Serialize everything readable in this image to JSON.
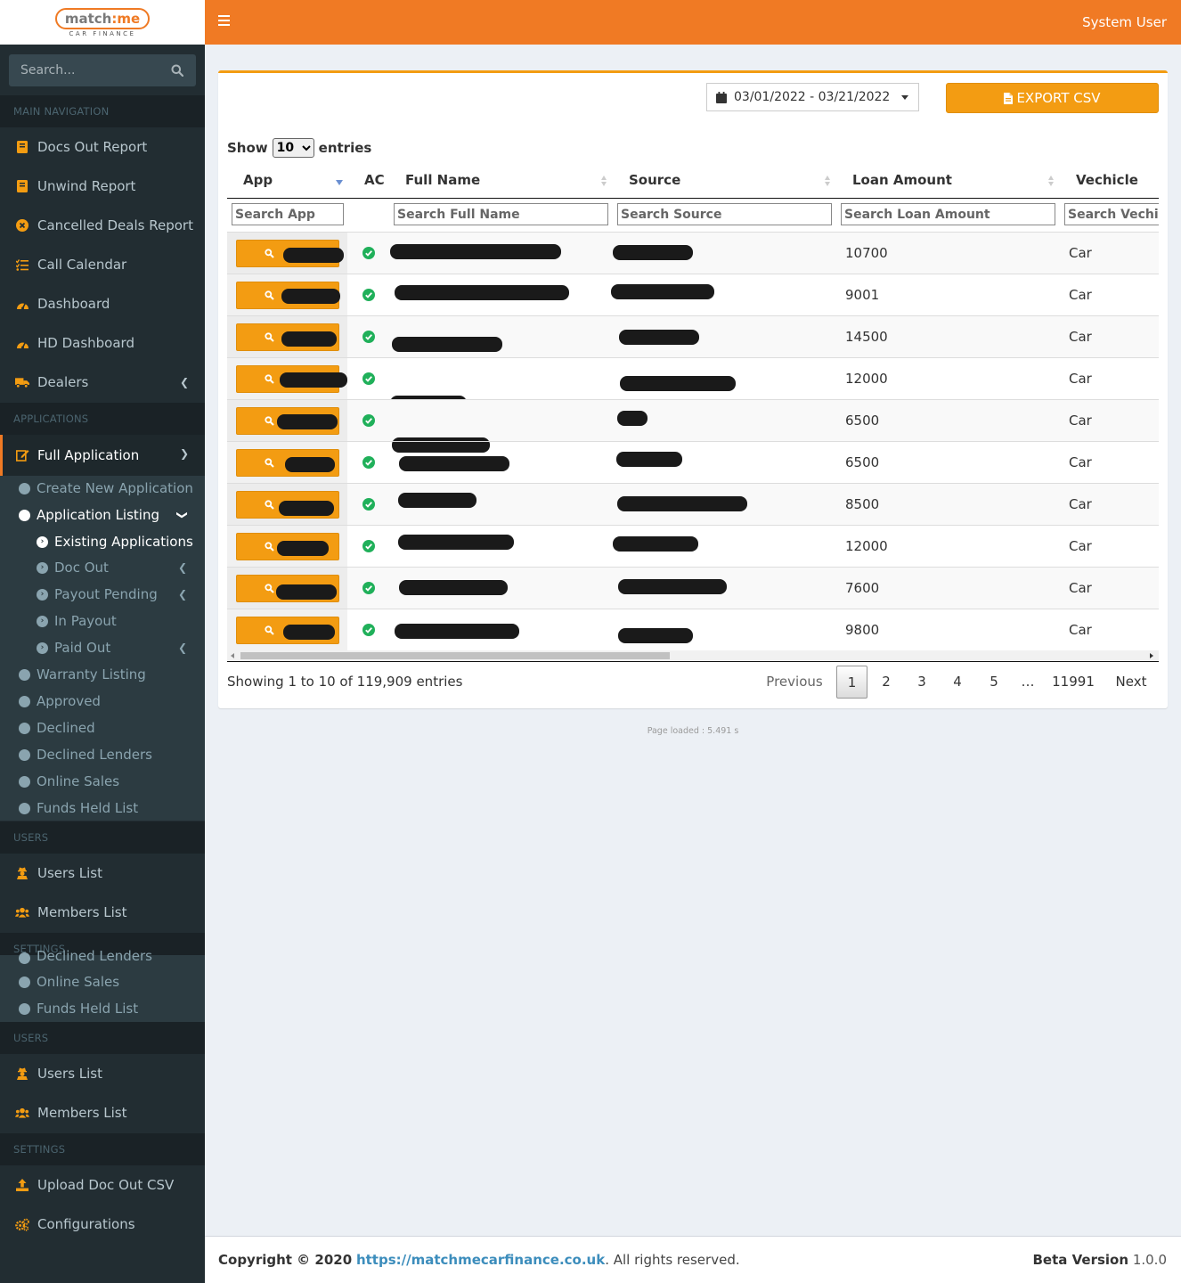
{
  "brand": {
    "logo_main": "match",
    "logo_colon": ":",
    "logo_end": "me",
    "logo_sub": "CAR FINANCE",
    "accent_color": "#f07a24"
  },
  "sidebar": {
    "search_placeholder": "Search...",
    "sections": {
      "main": "MAIN NAVIGATION",
      "applications": "APPLICATIONS",
      "users": "USERS",
      "settings": "SETTINGS"
    },
    "main_items": [
      {
        "label": "Docs Out Report",
        "icon": "book-icon"
      },
      {
        "label": "Unwind Report",
        "icon": "book-icon"
      },
      {
        "label": "Cancelled Deals Report",
        "icon": "times-circle-icon"
      },
      {
        "label": "Call Calendar",
        "icon": "tasks-icon"
      },
      {
        "label": "Dashboard",
        "icon": "tachometer-icon"
      },
      {
        "label": "HD Dashboard",
        "icon": "tachometer-icon"
      },
      {
        "label": "Dealers",
        "icon": "truck-icon"
      }
    ],
    "full_application": "Full Application",
    "sub_items": {
      "create_new": "Create New Application",
      "application_listing": "Application Listing",
      "existing": "Existing Applications",
      "doc_out": "Doc Out",
      "payout_pending": "Payout Pending",
      "in_payout": "In Payout",
      "paid_out": "Paid Out",
      "warranty": "Warranty Listing",
      "approved": "Approved",
      "declined": "Declined",
      "declined_lenders": "Declined Lenders",
      "online_sales": "Online Sales",
      "funds_held": "Funds Held List"
    },
    "users_items": {
      "users_list": "Users List",
      "members_list": "Members List"
    },
    "settings_items": {
      "upload_doc_out": "Upload Doc Out CSV",
      "configurations": "Configurations"
    }
  },
  "topbar": {
    "user": "System User"
  },
  "toolbar": {
    "date_range": "03/01/2022 - 03/21/2022",
    "export_label": "EXPORT CSV"
  },
  "table": {
    "show_label": "Show",
    "entries_label": "entries",
    "page_size": "10",
    "columns": {
      "app": "App",
      "ac": "AC",
      "full_name": "Full Name",
      "source": "Source",
      "loan_amount": "Loan Amount",
      "vehicle": "Vechicle"
    },
    "filters": {
      "app": "Search App",
      "full_name": "Search Full Name",
      "source": "Search Source",
      "loan_amount": "Search Loan Amount",
      "vehicle": "Search Vechicle"
    },
    "rows": [
      {
        "loan": "10700",
        "vehicle": "Car"
      },
      {
        "loan": "9001",
        "vehicle": "Car"
      },
      {
        "loan": "14500",
        "vehicle": "Car"
      },
      {
        "loan": "12000",
        "vehicle": "Car"
      },
      {
        "loan": "6500",
        "vehicle": "Car"
      },
      {
        "loan": "6500",
        "vehicle": "Car"
      },
      {
        "loan": "8500",
        "vehicle": "Car"
      },
      {
        "loan": "12000",
        "vehicle": "Car"
      },
      {
        "loan": "7600",
        "vehicle": "Car"
      },
      {
        "loan": "9800",
        "vehicle": "Car"
      }
    ],
    "info": "Showing 1 to 10 of 119,909 entries"
  },
  "pagination": {
    "previous": "Previous",
    "pages": [
      "1",
      "2",
      "3",
      "4",
      "5"
    ],
    "ellipsis": "…",
    "last": "11991",
    "next": "Next",
    "current": "1"
  },
  "page_loaded": "Page loaded : 5.491 s",
  "footer": {
    "copyright": "Copyright © 2020",
    "link": "https://matchmecarfinance.co.uk",
    "rights": ". All rights reserved.",
    "version_label": "Beta Version",
    "version": "1.0.0"
  }
}
